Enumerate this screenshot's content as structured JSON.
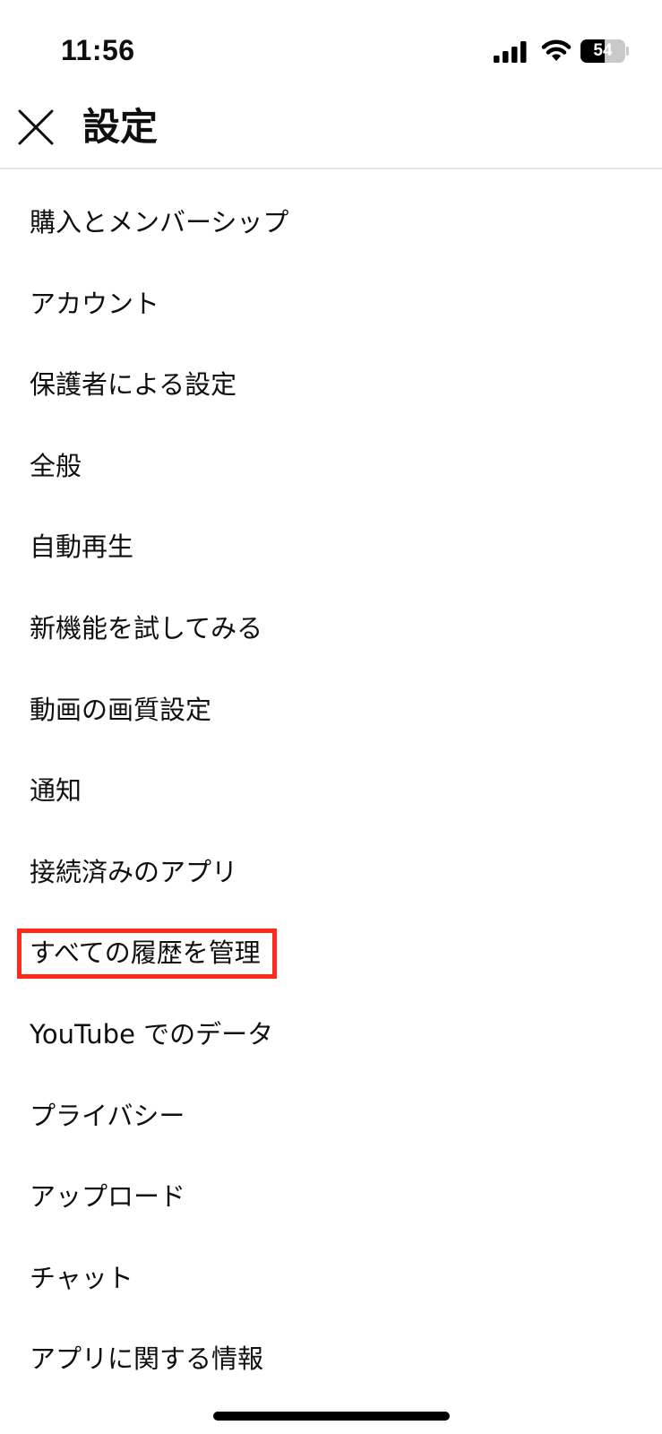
{
  "status_bar": {
    "time": "11:56",
    "battery_percent": 54,
    "battery_label": "54"
  },
  "header": {
    "title": "設定",
    "close_icon": "close-icon"
  },
  "settings": {
    "items": [
      {
        "label": "購入とメンバーシップ"
      },
      {
        "label": "アカウント"
      },
      {
        "label": "保護者による設定"
      },
      {
        "label": "全般"
      },
      {
        "label": "自動再生"
      },
      {
        "label": "新機能を試してみる"
      },
      {
        "label": "動画の画質設定"
      },
      {
        "label": "通知"
      },
      {
        "label": "接続済みのアプリ"
      },
      {
        "label": "すべての履歴を管理",
        "highlighted": true
      },
      {
        "label": "YouTube でのデータ"
      },
      {
        "label": "プライバシー"
      },
      {
        "label": "アップロード"
      },
      {
        "label": "チャット"
      },
      {
        "label": "アプリに関する情報"
      }
    ]
  },
  "colors": {
    "text": "#0f0f0f",
    "divider": "#e5e5e5",
    "highlight": "#ff2a1a"
  }
}
